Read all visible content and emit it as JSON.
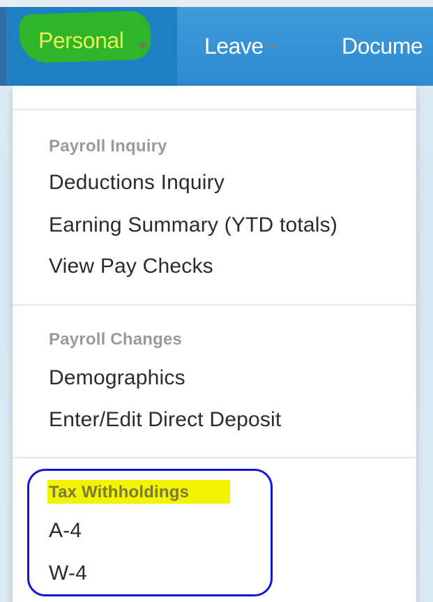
{
  "navbar": {
    "items": [
      {
        "label": "Personal",
        "active": true
      },
      {
        "label": "Leave"
      },
      {
        "label": "Docume"
      }
    ]
  },
  "dropdown": {
    "sections": [
      {
        "header": "Payroll Inquiry",
        "items": [
          "Deductions Inquiry",
          "Earning Summary (YTD totals)",
          "View Pay Checks"
        ]
      },
      {
        "header": "Payroll Changes",
        "items": [
          "Demographics",
          "Enter/Edit Direct Deposit"
        ]
      },
      {
        "header": "Tax Withholdings",
        "items": [
          "A-4",
          "W-4"
        ]
      }
    ]
  },
  "colors": {
    "navbar": "#2e8bd0",
    "active_tab": "#1e7fc2",
    "annotation_green": "#2fb52a",
    "annotation_yellow": "#f3f300",
    "annotation_outline": "#1414d8"
  }
}
